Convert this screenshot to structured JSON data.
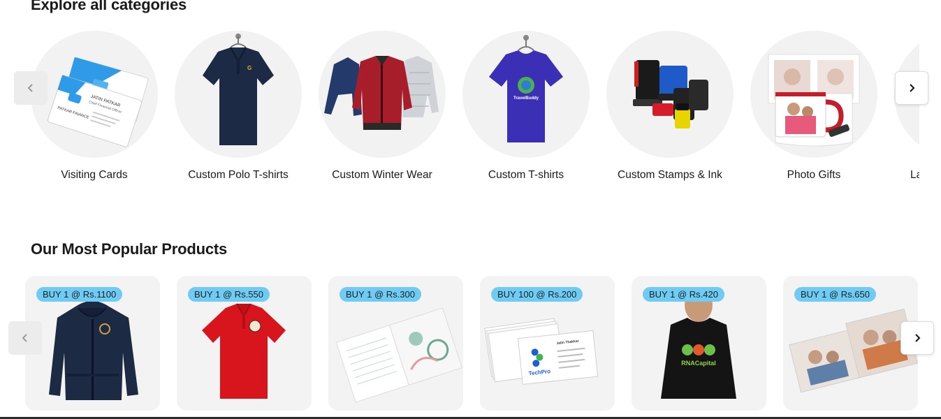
{
  "categories": {
    "title": "Explore all categories",
    "items": [
      {
        "label": "Visiting Cards"
      },
      {
        "label": "Custom Polo T-shirts"
      },
      {
        "label": "Custom Winter Wear"
      },
      {
        "label": "Custom T-shirts"
      },
      {
        "label": "Custom Stamps & Ink"
      },
      {
        "label": "Photo Gifts"
      },
      {
        "label": "La"
      }
    ],
    "card_text": {
      "name": "JATIN PATKAR",
      "role": "Chief Financial Officer",
      "company": "PATKAR FINANCE"
    },
    "tshirt_brand": "TravelBuddy"
  },
  "popular": {
    "title": "Our Most Popular Products",
    "items": [
      {
        "badge": "BUY 1 @ Rs.1100"
      },
      {
        "badge": "BUY 1 @ Rs.550"
      },
      {
        "badge": "BUY 1 @ Rs.300"
      },
      {
        "badge": "BUY 100 @ Rs.200"
      },
      {
        "badge": "BUY 1 @ Rs.420"
      },
      {
        "badge": "BUY 1 @ Rs.650"
      }
    ],
    "card_text": {
      "brand": "TechPro",
      "person": "Jatin Thakkar"
    },
    "tee_brand": "RNACapital"
  },
  "colors": {
    "accent_badge": "#6fcbf2",
    "circle_bg": "#f2f2f2",
    "card_bg": "#f3f3f3"
  },
  "icons": {
    "prev": "chevron-left-icon",
    "next": "chevron-right-icon"
  }
}
